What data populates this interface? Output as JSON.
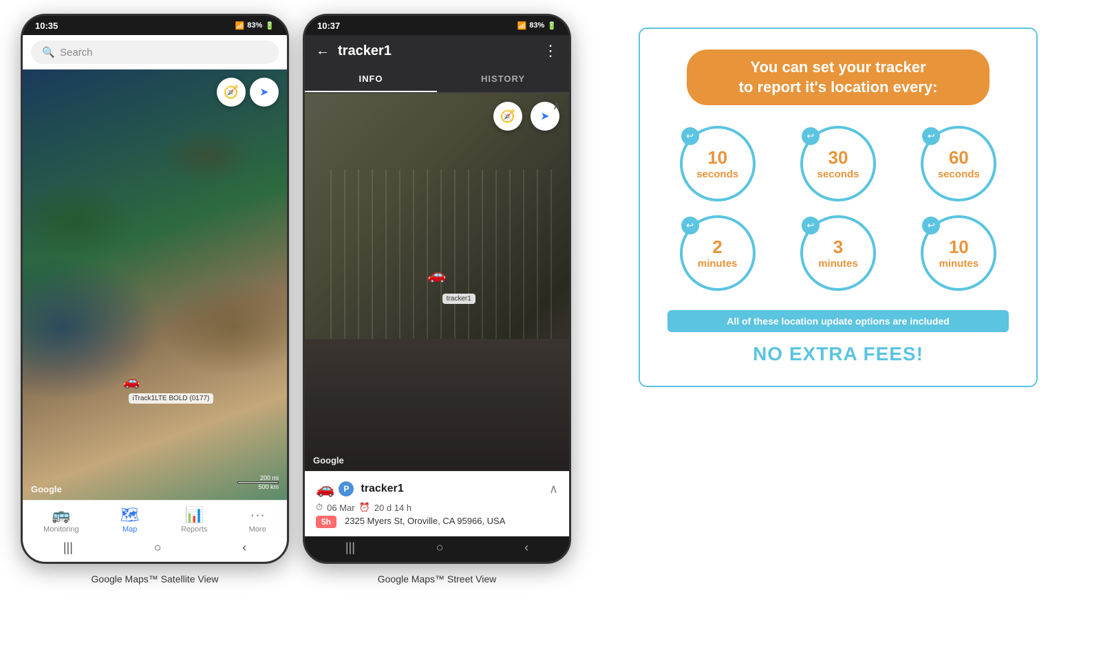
{
  "phone1": {
    "status_time": "10:35",
    "battery": "83%",
    "search_placeholder": "Search",
    "compass_icon": "🧭",
    "navigate_icon": "➤",
    "google_label": "Google",
    "scale_200mi": "200 mi",
    "scale_500km": "500 km",
    "tracker_label": "iTrack1LTE BOLD (0177)",
    "nav_items": [
      {
        "label": "Monitoring",
        "icon": "🚌",
        "active": false
      },
      {
        "label": "Map",
        "icon": "🗺",
        "active": true
      },
      {
        "label": "Reports",
        "icon": "📊",
        "active": false
      },
      {
        "label": "More",
        "icon": "···",
        "active": false
      }
    ]
  },
  "phone2": {
    "status_time": "10:37",
    "battery": "83%",
    "back_arrow": "←",
    "tracker_name": "tracker1",
    "dots_menu": "⋮",
    "tab_info": "INFO",
    "tab_history": "HISTORY",
    "compass_icon": "🧭",
    "navigate_icon": "➤",
    "google_label": "Google",
    "car_label": "tracker1",
    "info_tracker_name": "tracker1",
    "info_date": "06 Mar",
    "info_duration": "20 d 14 h",
    "info_address": "2325 Myers St, Oroville, CA 95966, USA",
    "time_badge": "5h"
  },
  "captions": {
    "phone1": "Google Maps™ Satellite View",
    "phone2": "Google Maps™ Street View"
  },
  "info_panel": {
    "title_line1": "You can set your tracker",
    "title_line2": "to report it's location every:",
    "circles": [
      {
        "number": "10",
        "unit": "seconds"
      },
      {
        "number": "30",
        "unit": "seconds"
      },
      {
        "number": "60",
        "unit": "seconds"
      },
      {
        "number": "2",
        "unit": "minutes"
      },
      {
        "number": "3",
        "unit": "minutes"
      },
      {
        "number": "10",
        "unit": "minutes"
      }
    ],
    "included_text": "All of these location update options are included",
    "no_fees_text": "NO EXTRA FEES!"
  }
}
